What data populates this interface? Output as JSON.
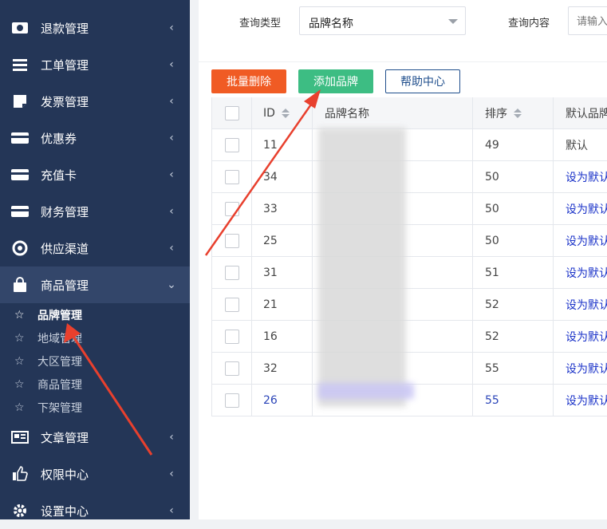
{
  "sidebar": {
    "items": [
      {
        "icon": "money-icon",
        "label": "退款管理",
        "chevron": "‹"
      },
      {
        "icon": "list-icon",
        "label": "工单管理",
        "chevron": "‹"
      },
      {
        "icon": "invoice-icon",
        "label": "发票管理",
        "chevron": "‹"
      },
      {
        "icon": "card-icon",
        "label": "优惠券",
        "chevron": "‹"
      },
      {
        "icon": "card-icon",
        "label": "充值卡",
        "chevron": "‹"
      },
      {
        "icon": "card-icon",
        "label": "财务管理",
        "chevron": "‹"
      },
      {
        "icon": "lifebuoy-icon",
        "label": "供应渠道",
        "chevron": "‹"
      },
      {
        "icon": "bag-icon",
        "label": "商品管理",
        "chevron": "⌄"
      },
      {
        "icon": "newspaper-icon",
        "label": "文章管理",
        "chevron": "‹"
      },
      {
        "icon": "thumbs-up-icon",
        "label": "权限中心",
        "chevron": "‹"
      },
      {
        "icon": "gear-icon",
        "label": "设置中心",
        "chevron": "‹"
      }
    ],
    "subitems": [
      {
        "label": "品牌管理",
        "star": "☆"
      },
      {
        "label": "地域管理",
        "star": "☆"
      },
      {
        "label": "大区管理",
        "star": "☆"
      },
      {
        "label": "商品管理",
        "star": "☆"
      },
      {
        "label": "下架管理",
        "star": "☆"
      }
    ]
  },
  "filter": {
    "type_label": "查询类型",
    "type_value": "品牌名称",
    "content_label": "查询内容",
    "content_placeholder": "请输入"
  },
  "toolbar": {
    "delete_label": "批量删除",
    "add_label": "添加品牌",
    "help_label": "帮助中心"
  },
  "table": {
    "headers": {
      "id": "ID",
      "name": "品牌名称",
      "sort": "排序",
      "default": "默认品牌"
    },
    "rows": [
      {
        "id": "11",
        "sort": "49",
        "default": "默认"
      },
      {
        "id": "34",
        "sort": "50",
        "default": "设为默认"
      },
      {
        "id": "33",
        "sort": "50",
        "default": "设为默认"
      },
      {
        "id": "25",
        "sort": "50",
        "default": "设为默认"
      },
      {
        "id": "31",
        "sort": "51",
        "default": "设为默认"
      },
      {
        "id": "21",
        "sort": "52",
        "default": "设为默认"
      },
      {
        "id": "16",
        "sort": "52",
        "default": "设为默认"
      },
      {
        "id": "32",
        "sort": "55",
        "default": "设为默认"
      },
      {
        "id": "26",
        "sort": "55",
        "default": "设为默认"
      }
    ]
  },
  "colors": {
    "sidebar": "#243657",
    "delete": "#f05b24",
    "add": "#3dbd83",
    "help_border": "#1f4e8c",
    "link": "#1a32c8",
    "annotation_arrow": "#e8402e"
  }
}
